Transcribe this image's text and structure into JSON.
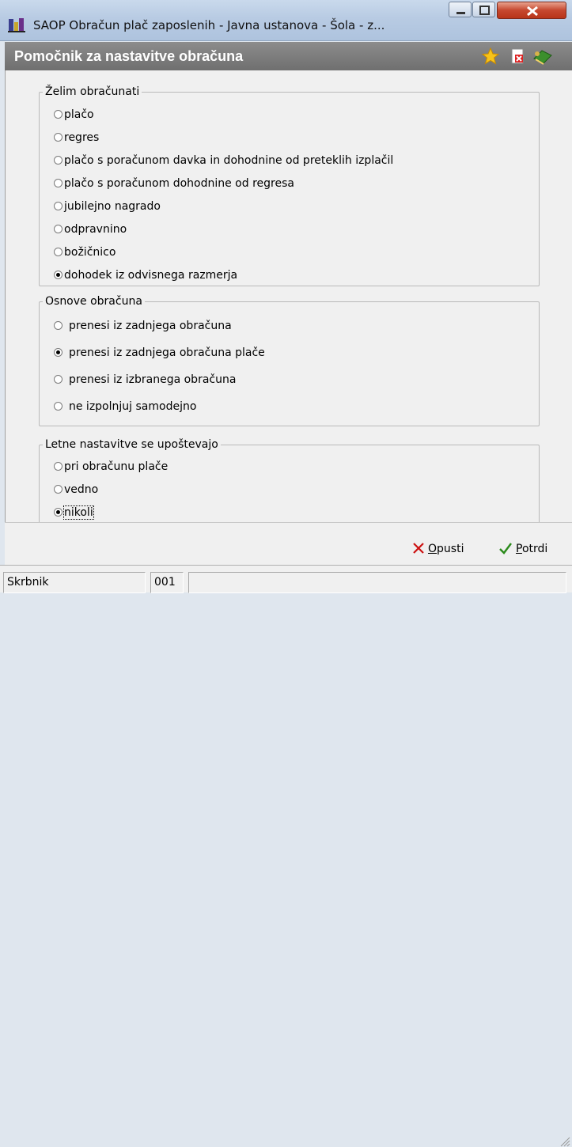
{
  "window": {
    "title": "SAOP  Obračun plač zaposlenih - Javna ustanova - Šola - z..."
  },
  "header": {
    "title": "Pomočnik za nastavitve obračuna",
    "icons": [
      "star-icon",
      "delete-document-icon",
      "exit-book-icon"
    ]
  },
  "groups": [
    {
      "legend": "Želim obračunati",
      "options": [
        {
          "label": "plačo",
          "checked": false
        },
        {
          "label": "regres",
          "checked": false
        },
        {
          "label": "plačo s poračunom davka in dohodnine od preteklih izplačil",
          "checked": false
        },
        {
          "label": "plačo s poračunom dohodnine od regresa",
          "checked": false
        },
        {
          "label": "jubilejno nagrado",
          "checked": false
        },
        {
          "label": "odpravnino",
          "checked": false
        },
        {
          "label": "božičnico",
          "checked": false
        },
        {
          "label": "dohodek iz odvisnega razmerja",
          "checked": true
        }
      ]
    },
    {
      "legend": "Osnove obračuna",
      "options": [
        {
          "label": "prenesi iz zadnjega obračuna",
          "checked": false
        },
        {
          "label": "prenesi iz zadnjega obračuna plače",
          "checked": true
        },
        {
          "label": "prenesi iz izbranega obračuna",
          "checked": false
        },
        {
          "label": "ne izpolnjuj samodejno",
          "checked": false
        }
      ]
    },
    {
      "legend": "Letne nastavitve se upoštevajo",
      "options": [
        {
          "label": "pri obračunu plače",
          "checked": false
        },
        {
          "label": "vedno",
          "checked": false
        },
        {
          "label": "nikoli",
          "checked": true,
          "focused": true
        }
      ]
    }
  ],
  "footer": {
    "cancel_label": "Opusti",
    "cancel_mnemonic": "O",
    "cancel_rest": "pusti",
    "confirm_label": "Potrdi",
    "confirm_mnemonic": "P",
    "confirm_rest": "otrdi"
  },
  "statusbar": {
    "user": "Skrbnik",
    "code": "001"
  },
  "colors": {
    "cancel_icon": "#cc1111",
    "confirm_icon": "#2a8a1a",
    "header_bg": "#7d7d7d"
  }
}
